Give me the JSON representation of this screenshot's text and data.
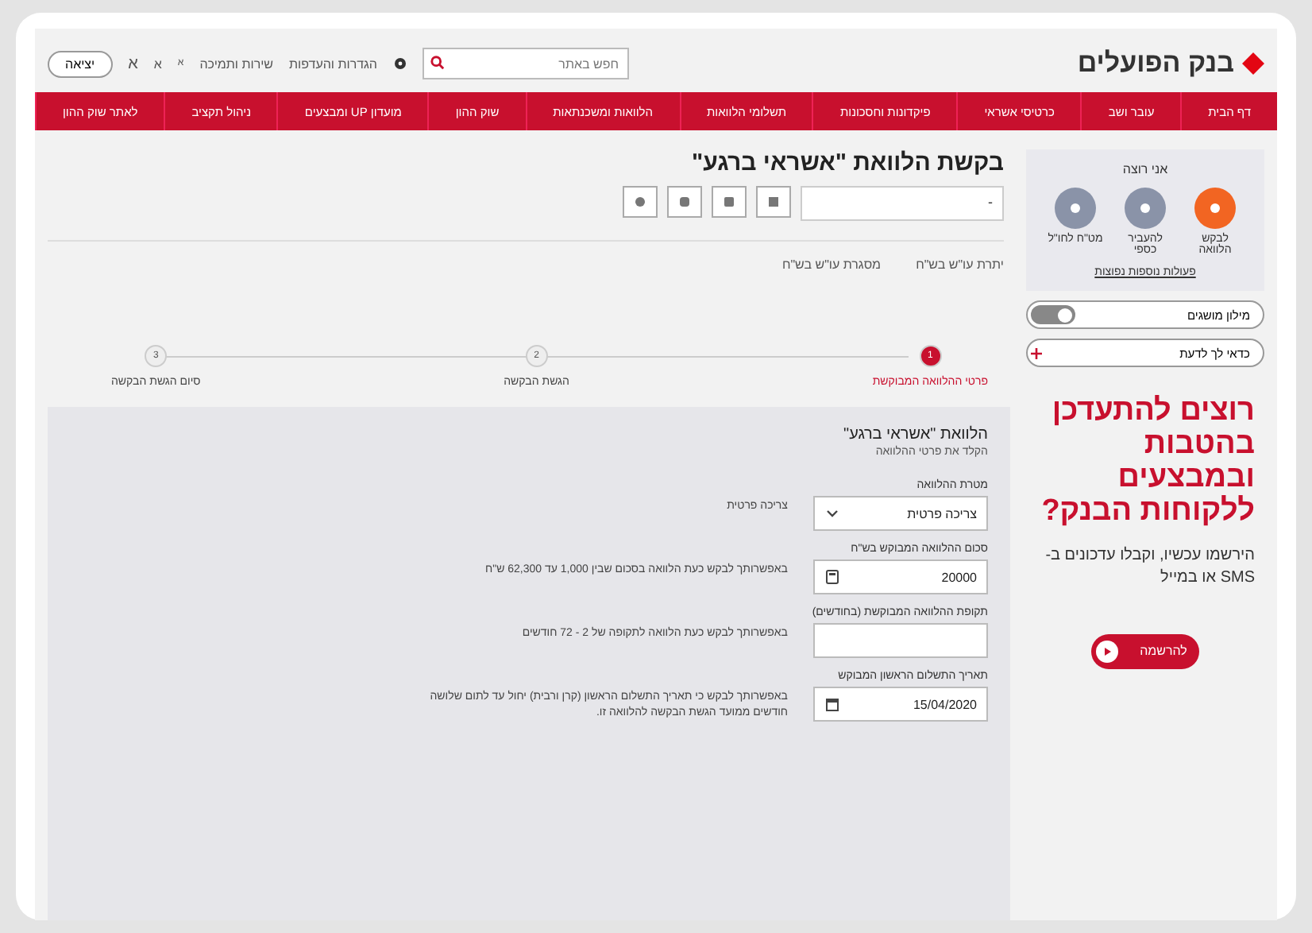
{
  "header": {
    "logo": "בנק הפועלים",
    "search": {
      "placeholder": "חפש באתר"
    },
    "links": [
      "הגדרות והעדפות",
      "שירות ותמיכה"
    ],
    "font_sizes": [
      "א",
      "א",
      "א"
    ],
    "logout": "יציאה"
  },
  "nav": [
    "דף הבית",
    "עובר ושב",
    "כרטיסי אשראי",
    "פיקדונות וחסכונות",
    "תשלומי הלוואות",
    "הלוואות ומשכנתאות",
    "שוק ההון",
    "מועדון UP ומבצעים",
    "ניהול תקציב",
    "לאתר שוק ההון"
  ],
  "page": {
    "title": "בקשת הלוואת \"אשראי ברגע\"",
    "account_select": {
      "value": "-"
    },
    "balances": [
      "יתרת עו\"ש בש\"ח",
      "מסגרת עו\"ש בש\"ח"
    ],
    "steps": [
      {
        "number": "1",
        "label": "פרטי ההלוואה המבוקשת",
        "selected": true
      },
      {
        "number": "2",
        "label": "הגשת הבקשה",
        "selected": false
      },
      {
        "number": "3",
        "label": "סיום הגשת הבקשה",
        "selected": false
      }
    ],
    "form": {
      "title": "הלוואת \"אשראי ברגע\"",
      "subtitle": "הקלד את פרטי ההלוואה",
      "fields": [
        {
          "kind": "select",
          "label": "מטרת ההלוואה",
          "value": "צריכה פרטית",
          "note": "צריכה פרטית"
        },
        {
          "kind": "amount",
          "label": "סכום ההלוואה המבוקש בש\"ח",
          "value": "20000",
          "note": "באפשרותך לבקש כעת הלוואה בסכום שבין 1,000 עד 62,300 ש\"ח"
        },
        {
          "kind": "text",
          "label": "תקופת ההלוואה המבוקשת (בחודשים)",
          "note": "באפשרותך לבקש כעת הלוואה לתקופה של 2 - 72 חודשים"
        },
        {
          "kind": "date",
          "label": "תאריך התשלום הראשון המבוקש",
          "value": "15/04/2020",
          "note": "באפשרותך לבקש כי תאריך התשלום הראשון (קרן ורבית) יחול עד לתום שלושה חודשים ממועד הגשת הבקשה להלוואה זו."
        }
      ]
    }
  },
  "sidebar": {
    "title": "אני רוצה",
    "actions": [
      {
        "label": "לבקש הלוואה",
        "selected": true
      },
      {
        "label": "להעביר כספי",
        "selected": false
      },
      {
        "label": "מט\"ח לחו\"ל",
        "selected": false
      }
    ],
    "more_link": "פעולות נוספות נפוצות",
    "toggles": [
      {
        "kind": "switch",
        "label": "מילון מושגים",
        "on": true
      },
      {
        "kind": "expand",
        "label": "כדאי לך לדעת"
      }
    ],
    "promo": {
      "title": "רוצים להתעדכן בהטבות ובמבצעים ללקוחות הבנק?",
      "text": "הירשמו עכשיו, וקבלו עדכונים ב-SMS או במייל",
      "button": "להרשמה"
    }
  }
}
